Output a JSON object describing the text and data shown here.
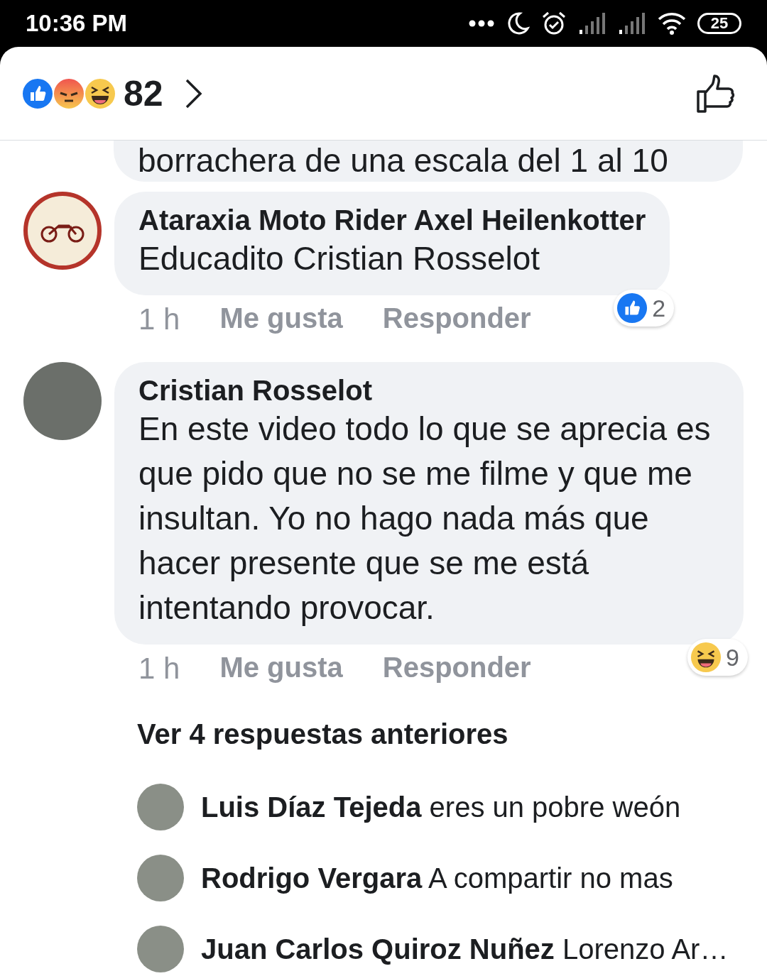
{
  "status_bar": {
    "time": "10:36 PM",
    "battery": "25"
  },
  "header": {
    "reaction_count": "82"
  },
  "partial_comment": {
    "text": "borrachera de una escala del 1 al 10"
  },
  "comments": [
    {
      "author": "Ataraxia Moto Rider Axel Heilenkotter",
      "avatar": {
        "kind": "logo"
      },
      "text": "Educadito Cristian Rosselot",
      "time": "1 h",
      "like_label": "Me gusta",
      "reply_label": "Responder",
      "reaction": {
        "kind": "like",
        "count": "2"
      }
    },
    {
      "author": "Cristian Rosselot",
      "avatar": {
        "kind": "photo"
      },
      "text": "En este video todo lo que se aprecia es que pido que no se me filme y que me insultan. Yo no hago nada más que hacer presente que se me está intentando provocar.",
      "time": "1 h",
      "like_label": "Me gusta",
      "reply_label": "Responder",
      "reaction": {
        "kind": "haha",
        "count": "9"
      }
    }
  ],
  "replies_link": "Ver 4 respuestas anteriores",
  "replies": [
    {
      "author": "Luis Díaz Tejeda",
      "text": "eres un pobre weón"
    },
    {
      "author": "Rodrigo Vergara",
      "text": "A compartir no mas"
    },
    {
      "author": "Juan Carlos Quiroz Nuñez",
      "text": "Lorenzo Ar…"
    }
  ]
}
